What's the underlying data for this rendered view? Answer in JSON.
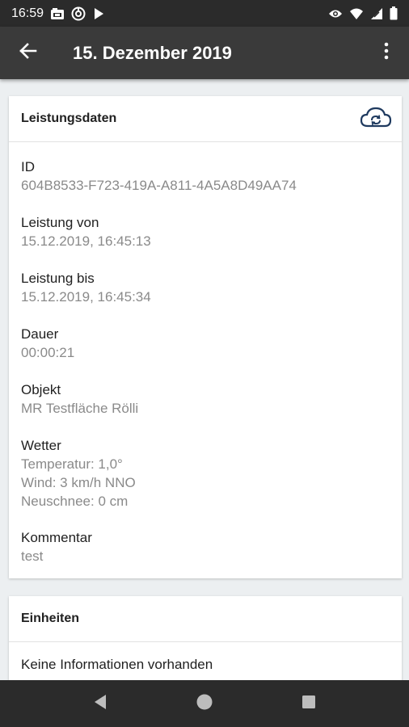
{
  "status_bar": {
    "time": "16:59",
    "left_icons": [
      "photo-notification-icon",
      "vpn-notification-icon",
      "play-notification-icon"
    ],
    "right_icons": [
      "eye-icon",
      "wifi-icon",
      "signal-icon",
      "battery-icon"
    ]
  },
  "app_bar": {
    "title": "15. Dezember 2019",
    "back_icon": "arrow-back-icon",
    "menu_icon": "more-vertical-icon"
  },
  "performance_card": {
    "title": "Leistungsdaten",
    "cloud_icon": "cloud-sync-icon",
    "id_label": "ID",
    "id_value": "604B8533-F723-419A-A811-4A5A8D49AA74",
    "from_label": "Leistung von",
    "from_value": "15.12.2019, 16:45:13",
    "to_label": "Leistung bis",
    "to_value": "15.12.2019, 16:45:34",
    "duration_label": "Dauer",
    "duration_value": "00:00:21",
    "object_label": "Objekt",
    "object_value": "MR Testfläche Rölli",
    "weather_label": "Wetter",
    "weather_temperature": "Temperatur: 1,0°",
    "weather_wind": "Wind: 3 km/h NNO",
    "weather_snow": "Neuschnee: 0 cm",
    "comment_label": "Kommentar",
    "comment_value": "test"
  },
  "units_card": {
    "title": "Einheiten",
    "empty_text": "Keine Informationen vorhanden"
  },
  "nav_bar": {
    "icons": [
      "nav-back-icon",
      "nav-home-icon",
      "nav-recents-icon"
    ]
  },
  "colors": {
    "app_bar": "#3a3a3a",
    "status_bar": "#2b2b2b",
    "background": "#eceff1",
    "accent_icon": "#1f3a5f",
    "secondary_text": "#8a8a8a"
  }
}
